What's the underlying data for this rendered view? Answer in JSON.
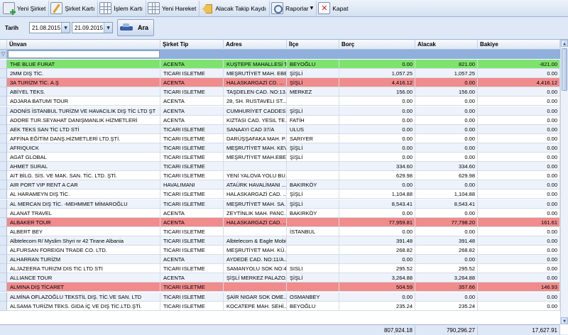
{
  "toolbar": {
    "new_company": "Yeni Şirket",
    "company_card": "Şirket Kartı",
    "transaction_card": "İşlem Kartı",
    "new_transaction": "Yeni Hareket",
    "receivable_record": "Alacak Takip Kaydı",
    "reports": "Raporlar",
    "close": "Kapat"
  },
  "filter": {
    "date_label": "Tarih",
    "start_date": "21.08.2015",
    "end_date": "21.09.2015",
    "search_label": "Ara"
  },
  "grid": {
    "columns": [
      "Ünvan",
      "Şirket Tip",
      "Adres",
      "İlçe",
      "Borç",
      "Alacak",
      "Bakiye"
    ],
    "rows": [
      [
        "THE BLUE FURAT",
        "ACENTA",
        "KUŞTEPE MAHALLESİ T...",
        "BEYOĞLU",
        "0.00",
        "821.00",
        "-821.00"
      ],
      [
        "2MM DIŞ TİC.",
        "TICARI ISLETME",
        "MEŞRUTİYET MAH. EBE...",
        "ŞİŞLİ",
        "1,057.25",
        "1,057.25",
        "0.00"
      ],
      [
        "3A TURİZM TİC. A.Ş",
        "ACENTA",
        "HALASKARGAZİ CD. ...",
        "ŞİŞLİ",
        "4,416.12",
        "0.00",
        "4,416.12"
      ],
      [
        "ABİYEL TEKS.",
        "TICARI ISLETME",
        "TAŞDELEN CAD. NO:13...",
        "MERKEZ",
        "156.00",
        "156.00",
        "0.00"
      ],
      [
        "ADJARA BATUMI TOUR",
        "ACENTA",
        "28, SH. RUSTAVELI ST...",
        "",
        "0.00",
        "0.00",
        "0.00"
      ],
      [
        "ADONİS İSTANBUL TURİZM VE HAVACILIK DIŞ TİC LTD ŞT",
        "ACENTA",
        "CUMHURİYET CADDESİ...",
        "ŞİŞLİ",
        "0.00",
        "0.00",
        "0.00"
      ],
      [
        "ADORE TUR.SEYAHAT DANIŞMANLIK HİZMETLERİ",
        "ACENTA",
        "KIZTASI CAD. YESIL TE...",
        "FATİH",
        "0.00",
        "0.00",
        "0.00"
      ],
      [
        "AEK TEKS SAN TİC LTD STİ",
        "TICARI ISLETME",
        "SANAAYI CAD 37/A",
        "ULUS",
        "0.00",
        "0.00",
        "0.00"
      ],
      [
        "AFFİNA EĞİTİM DANŞ.HİZMETLERİ LTD.ŞTİ.",
        "TICARI ISLETME",
        "DARÜŞŞAFAKA MAH. P...",
        "SARIYER",
        "0.00",
        "0.00",
        "0.00"
      ],
      [
        "AFRIQUICK",
        "TICARI ISLETME",
        "MEŞRUTİYET MAH. KEV...",
        "ŞİŞLİ",
        "0.00",
        "0.00",
        "0.00"
      ],
      [
        "AGAT GLOBAL",
        "TICARI ISLETME",
        "MEŞRUTİYET MAH.EBEKIZ...",
        "ŞİŞLİ",
        "0.00",
        "0.00",
        "0.00"
      ],
      [
        "AHMET SURAL",
        "TICARI ISLETME",
        "",
        "",
        "334.60",
        "334.60",
        "0.00"
      ],
      [
        "AIT BİLG. SİS. VE MAK. SAN. TİC. LTD. ŞTİ.",
        "TICARI ISLETME",
        "YENİ YALOVA YOLU BU...",
        "",
        "629.98",
        "629.98",
        "0.00"
      ],
      [
        "AIR PORT VIP RENT A CAR",
        "HAVALIMANI",
        "ATAÜRK HAVALİMANI ...",
        " BAKIRKÖY",
        "0.00",
        "0.00",
        "0.00"
      ],
      [
        "AL HARAMEYN DIŞ TİC.",
        "TICARI ISLETME",
        "HALASKARGAZİ CAD. ...",
        "ŞİŞLİ",
        "1,104.88",
        "1,104.88",
        "0.00"
      ],
      [
        "AL MERCAN DIŞ TİC. -MEHMMET MİMAROĞLU",
        "TICARI ISLETME",
        "MEŞRUTİYET MAH. SA...",
        "ŞİŞLİ",
        "8,543.41",
        "8,543.41",
        "0.00"
      ],
      [
        "ALANAT TRAVEL",
        "ACENTA",
        "ZEYTİNLIK MAH. PANC...",
        "BAKIRKÖY",
        "0.00",
        "0.00",
        "0.00"
      ],
      [
        "ALBAKER TOUR",
        "ACENTA",
        "HALASKARGAZİ CAD. ...",
        "",
        "77,959.81",
        "77,798.20",
        "161.61"
      ],
      [
        "ALBERT BEY",
        "TICARI ISLETME",
        "",
        "İSTANBUL",
        "0.00",
        "0.00",
        "0.00"
      ],
      [
        "Albtelecom R/ Myslim Shyri nr 42 Tirane Albania",
        "TICARI ISLETME",
        "Albtelecom & Eagle Mobile",
        "",
        "391.48",
        "391.48",
        "0.00"
      ],
      [
        "ALFURSAN FOREIGN TRADE CO. LTD.",
        "TICARI ISLETME",
        "MEŞRUTİYET MAH. KÜ...",
        "",
        "268.82",
        "268.82",
        "0.00"
      ],
      [
        "ALHARRAN TURİZM",
        "ACENTA",
        "AYDEDE CAD. NO:11/A...",
        "",
        "0.00",
        "0.00",
        "0.00"
      ],
      [
        "ALJAZEERA TURIZM DIS TIC LTD STI",
        "TICARI ISLETME",
        "SAMANYOLU SOK NO:4...",
        "SISLI",
        "295.52",
        "295.52",
        "0.00"
      ],
      [
        "ALLIANCE TOUR",
        "ACENTA",
        "ŞİŞLİ MERKEZ PALAZO...",
        "ŞİŞLİ",
        "3,264.88",
        "3,264.88",
        "0.00"
      ],
      [
        "ALMINA DIŞ TİCARET",
        "TICARI ISLETME",
        "",
        "",
        "504.59",
        "357.66",
        "146.93"
      ],
      [
        "ALMİNA OFLAZOĞLU TEKSTİL DIŞ. TİC.VE SAN. LTD",
        "TICARI ISLETME",
        "ŞAİR NIGAR SOK OME...",
        "OSMANBEY",
        "0.00",
        "0.00",
        "0.00"
      ],
      [
        "ALSAMA TURİZM TEKS. GIDA İÇ VE DIŞ TİC.LTD.ŞTİ.",
        "TICARI ISLETME",
        "KOCATEPE MAH. SEHİ...",
        "BEYOĞLU",
        "235.24",
        "235.24",
        "0.00"
      ]
    ],
    "row_status": [
      "green",
      "none",
      "red",
      "none",
      "none",
      "none",
      "none",
      "none",
      "none",
      "none",
      "none",
      "none",
      "none",
      "none",
      "none",
      "none",
      "none",
      "red",
      "none",
      "none",
      "none",
      "none",
      "none",
      "none",
      "red",
      "none",
      "none"
    ],
    "totals": {
      "borc": "807,924.18",
      "alacak": "790,296.27",
      "bakiye": "17,627.91"
    }
  },
  "colors": {
    "green_row": "#7ee36e",
    "red_row": "#f08c8c",
    "alt_row": "#eef3fb"
  }
}
